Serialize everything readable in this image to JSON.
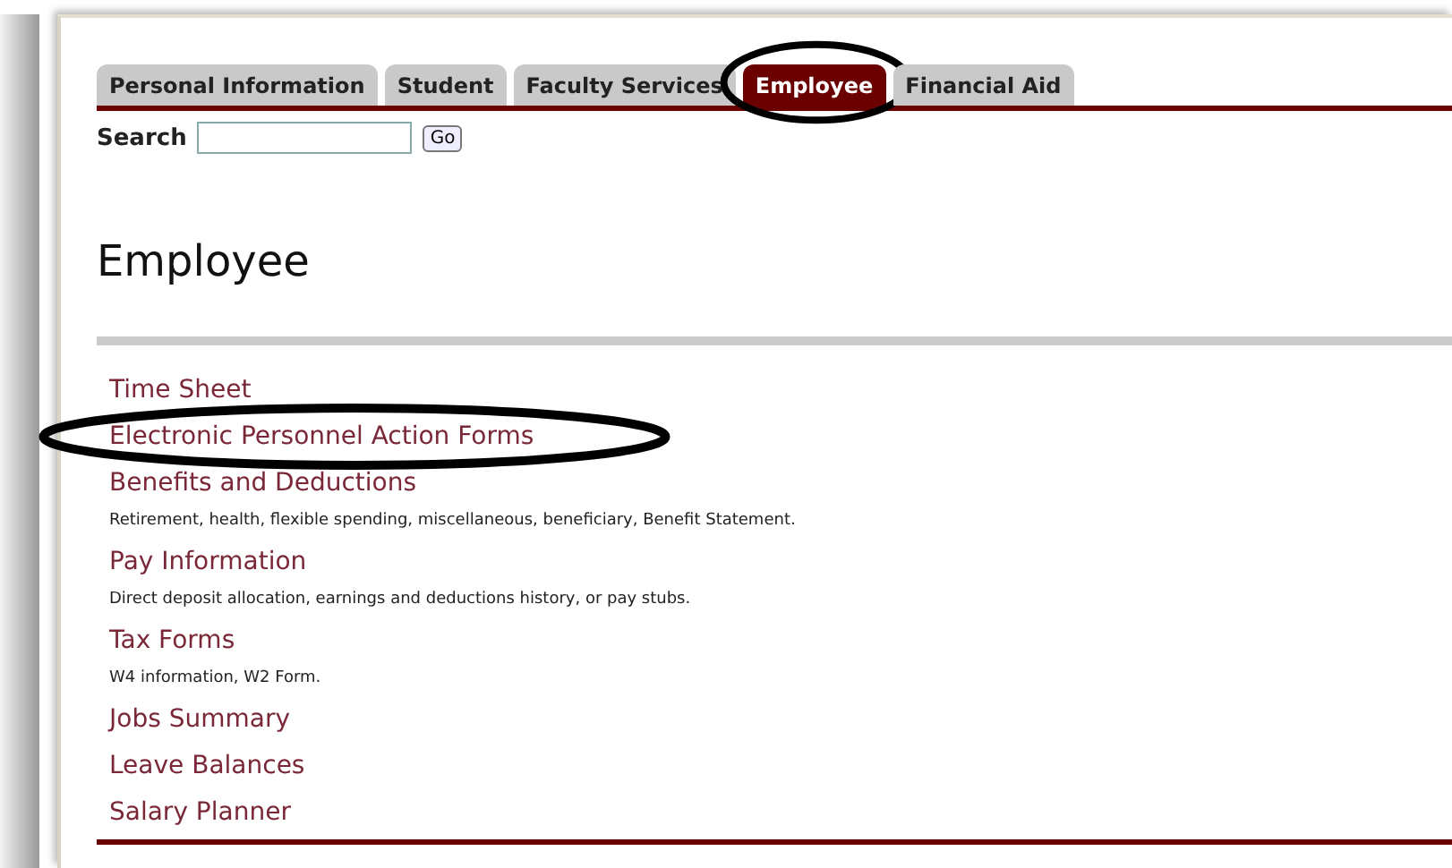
{
  "tabs": [
    {
      "label": "Personal Information",
      "selected": false,
      "circled": false
    },
    {
      "label": "Student",
      "selected": false,
      "circled": false
    },
    {
      "label": "Faculty Services",
      "selected": false,
      "circled": false
    },
    {
      "label": "Employee",
      "selected": true,
      "circled": true
    },
    {
      "label": "Financial Aid",
      "selected": false,
      "circled": false
    }
  ],
  "search": {
    "label": "Search",
    "button": "Go"
  },
  "heading": "Employee",
  "items": [
    {
      "title": "Time Sheet",
      "circled": false
    },
    {
      "title": "Electronic Personnel Action Forms",
      "circled": true
    },
    {
      "title": "Benefits and Deductions",
      "description": "Retirement, health, flexible spending, miscellaneous, beneficiary, Benefit Statement.",
      "circled": false
    },
    {
      "title": "Pay Information",
      "description": "Direct deposit allocation, earnings and deductions history, or pay stubs.",
      "circled": false
    },
    {
      "title": "Tax Forms",
      "description": "W4 information, W2 Form.",
      "circled": false
    },
    {
      "title": "Jobs Summary",
      "circled": false
    },
    {
      "title": "Leave Balances",
      "circled": false
    },
    {
      "title": "Salary Planner",
      "circled": false
    }
  ]
}
